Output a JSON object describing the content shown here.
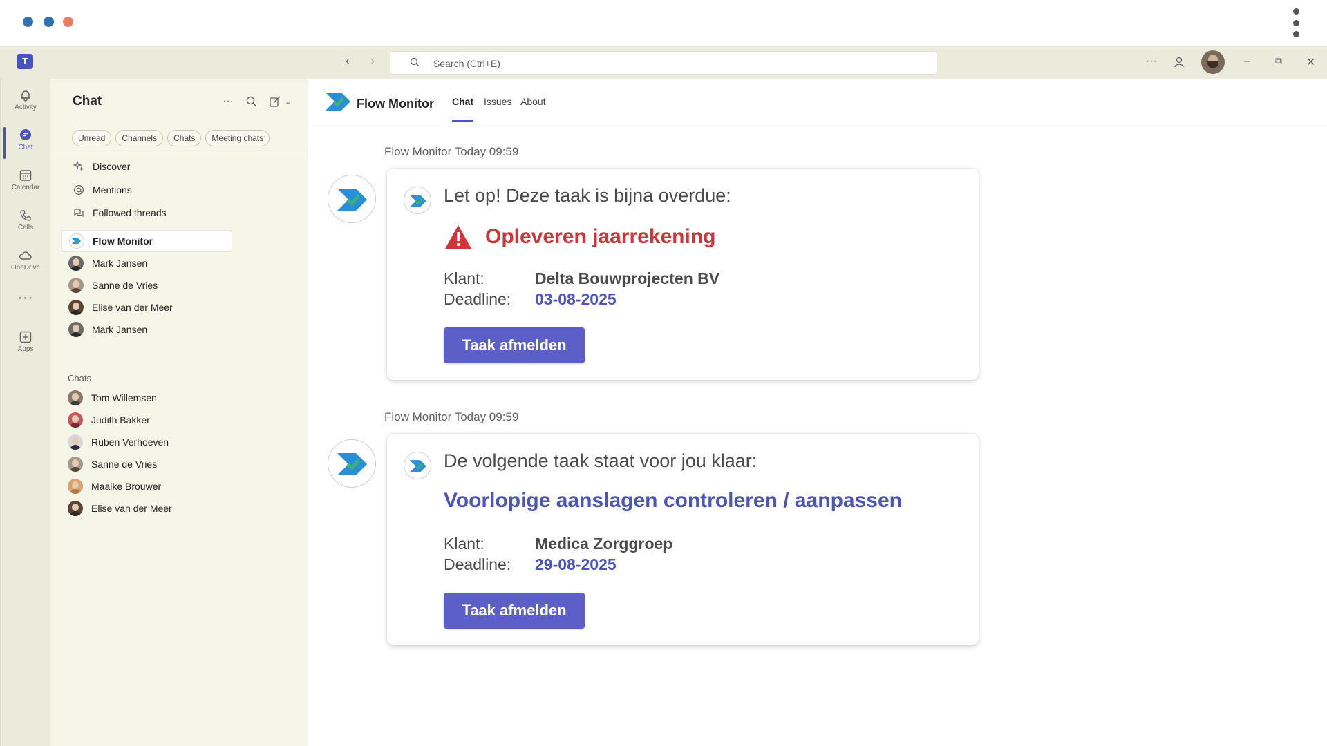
{
  "app": {
    "search_placeholder": "Search (Ctrl+E)"
  },
  "rail": {
    "items": [
      {
        "label": "Activity",
        "icon": "bell-icon"
      },
      {
        "label": "Chat",
        "icon": "chat-icon"
      },
      {
        "label": "Calendar",
        "icon": "calendar-icon"
      },
      {
        "label": "Calls",
        "icon": "phone-icon"
      },
      {
        "label": "OneDrive",
        "icon": "cloud-icon"
      },
      {
        "label": "Apps",
        "icon": "add-app-icon"
      }
    ],
    "more": "···"
  },
  "chat_pane": {
    "title": "Chat",
    "filters": [
      "Unread",
      "Channels",
      "Chats",
      "Meeting chats"
    ],
    "nav": [
      "Discover",
      "Mentions",
      "Followed threads"
    ],
    "pinned": [
      "Flow Monitor",
      "Mark Jansen",
      "Sanne de Vries",
      "Elise van der Meer",
      "Mark Jansen"
    ],
    "chats_label": "Chats",
    "chats": [
      "Tom Willemsen",
      "Judith Bakker",
      "Ruben Verhoeven",
      "Sanne de Vries",
      "Maaike Brouwer",
      "Elise van der Meer"
    ]
  },
  "main": {
    "app_name": "Flow Monitor",
    "tabs": [
      "Chat",
      "Issues",
      "About"
    ],
    "active_tab": "Chat",
    "messages": [
      {
        "meta": "Flow Monitor Today 09:59",
        "intro": "Let op! Deze taak is bijna overdue:",
        "task": "Opleveren jaarrekening",
        "task_color": "#d13438",
        "klant_label": "Klant:",
        "klant": "Delta Bouwprojecten BV",
        "deadline_label": "Deadline:",
        "deadline": "03-08-2025",
        "button": "Taak afmelden"
      },
      {
        "meta": "Flow Monitor Today 09:59",
        "intro": "De volgende taak staat voor jou klaar:",
        "task": "Voorlopige aanslagen controleren / aanpassen",
        "task_color": "#4b53bc",
        "klant_label": "Klant:",
        "klant": "Medica Zorggroep",
        "deadline_label": "Deadline:",
        "deadline": "29-08-2025",
        "button": "Taak afmelden"
      }
    ]
  },
  "colors": {
    "accent": "#4b53bc",
    "button": "#5b5fc7",
    "warning": "#d13438",
    "titlebar": "#ebebdc"
  }
}
